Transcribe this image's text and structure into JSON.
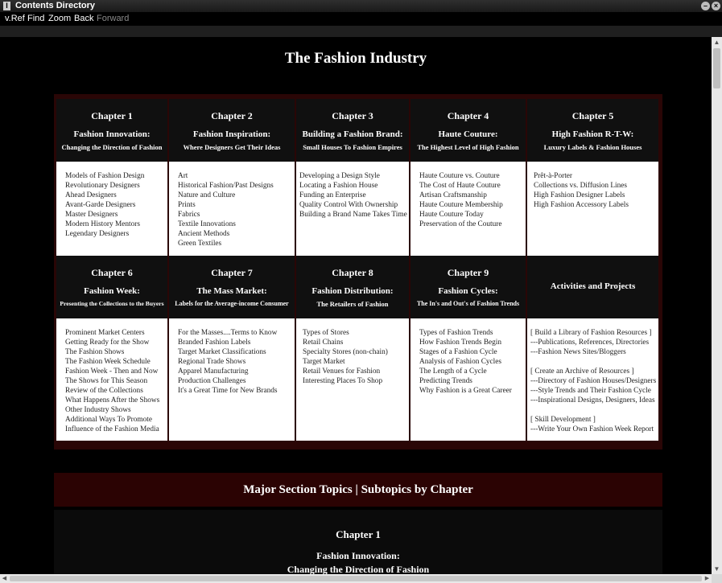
{
  "window": {
    "title": "Contents Directory",
    "icon": "I"
  },
  "menu": [
    {
      "label": "v.Ref",
      "enabled": true
    },
    {
      "label": "Find",
      "enabled": true
    },
    {
      "label": "Zoom",
      "enabled": true
    },
    {
      "label": "Back",
      "enabled": true
    },
    {
      "label": "Forward",
      "enabled": false
    }
  ],
  "page": {
    "title": "The Fashion Industry"
  },
  "chapters": [
    {
      "chapter": "Chapter 1",
      "name": "Fashion Innovation:",
      "subtitle": "Changing the Direction of Fashion",
      "topics": [
        "Models of Fashion Design",
        "Revolutionary Designers",
        "Ahead Designers",
        "Avant-Garde Designers",
        "Master Designers",
        "Modern History Mentors",
        "Legendary Designers"
      ]
    },
    {
      "chapter": "Chapter 2",
      "name": "Fashion Inspiration:",
      "subtitle": "Where Designers Get Their Ideas",
      "topics": [
        "Art",
        "Historical Fashion/Past Designs",
        "Nature and Culture",
        "Prints",
        "Fabrics",
        "Textile Innovations",
        "Ancient Methods",
        "Green Textiles"
      ]
    },
    {
      "chapter": "Chapter 3",
      "name": "Building a Fashion Brand:",
      "subtitle": "Small Houses To Fashion Empires",
      "topics": [
        "Developing a Design Style",
        "Locating a Fashion House",
        "Funding an Enterprise",
        "Quality Control With Ownership",
        "Building a Brand Name Takes Time"
      ]
    },
    {
      "chapter": "Chapter 4",
      "name": "Haute Couture:",
      "subtitle": "The Highest Level of High Fashion",
      "topics": [
        "Haute Couture vs. Couture",
        "The Cost of Haute Couture",
        "Artisan Craftsmanship",
        "Haute Couture Membership",
        "Haute Couture Today",
        "Preservation of the Couture"
      ]
    },
    {
      "chapter": "Chapter 5",
      "name": "High Fashion R-T-W:",
      "subtitle": "Luxury Labels & Fashion Houses",
      "topics": [
        "Prêt-à-Porter",
        "Collections vs. Diffusion Lines",
        "High Fashion Designer Labels",
        "High Fashion Accessory Labels"
      ]
    },
    {
      "chapter": "Chapter 6",
      "name": "Fashion Week:",
      "subtitle": "Presenting the Collections to the Buyers",
      "topics": [
        "Prominent Market Centers",
        "Getting Ready for the Show",
        "The Fashion Shows",
        "The Fashion Week Schedule",
        "Fashion Week - Then and Now",
        "The Shows for This Season",
        "Review of the Collections",
        "What Happens After the Shows",
        "Other Industry Shows",
        "Additional Ways To Promote",
        "Influence of the Fashion Media"
      ]
    },
    {
      "chapter": "Chapter 7",
      "name": "The Mass Market:",
      "subtitle": "Labels for the Average-income Consumer",
      "topics": [
        "For the Masses....Terms to Know",
        "Branded Fashion Labels",
        "Target Market Classifications",
        "Regional Trade Shows",
        "Apparel Manufacturing",
        "Production Challenges",
        "It's a Great Time for New Brands"
      ]
    },
    {
      "chapter": "Chapter 8",
      "name": "Fashion Distribution:",
      "subtitle": "The Retailers of Fashion",
      "topics": [
        "Types of Stores",
        "Retail Chains",
        "Specialty Stores (non-chain)",
        "Target Market",
        "Retail Venues for Fashion",
        "Interesting Places To Shop"
      ]
    },
    {
      "chapter": "Chapter 9",
      "name": "Fashion Cycles:",
      "subtitle": "The In's and Out's of Fashion Trends",
      "topics": [
        "Types of Fashion Trends",
        "How Fashion Trends Begin",
        "Stages of a Fashion Cycle",
        "Analysis of Fashion Cycles",
        "The Length of a Cycle",
        "Predicting Trends",
        "Why Fashion is a Great Career"
      ]
    }
  ],
  "activities": {
    "title": "Activities and Projects",
    "items": [
      "[ Build a Library of Fashion Resources ]",
      "---Publications, References, Directories",
      "---Fashion News Sites/Bloggers",
      "",
      "[ Create an Archive of Resources ]",
      "---Directory of Fashion Houses/Designers",
      "---Style Trends and Their Fashion Cycle",
      "---Inspirational Designs, Designers, Ideas",
      "",
      "[ Skill Development ]",
      "---Write Your Own Fashion Week Report"
    ]
  },
  "section": {
    "title": "Major Section Topics | Subtopics by Chapter"
  },
  "chapter_preview": {
    "chapter": "Chapter 1",
    "name": "Fashion Innovation:",
    "subtitle": "Changing the Direction of Fashion"
  }
}
